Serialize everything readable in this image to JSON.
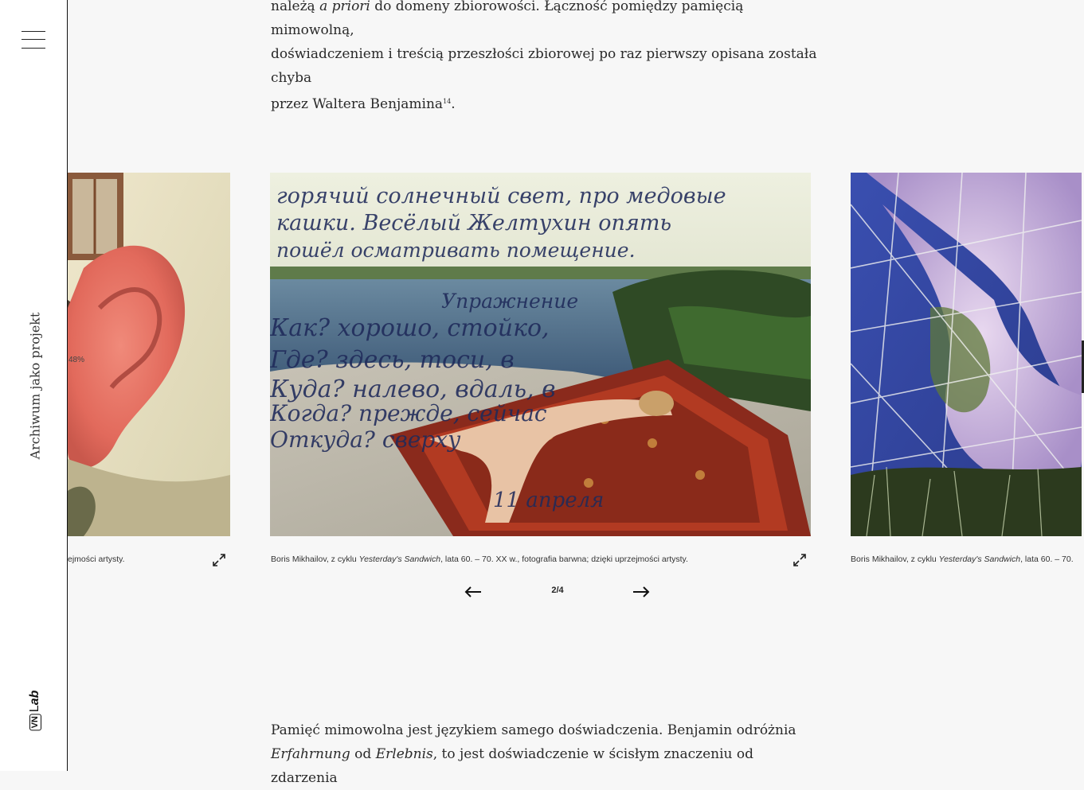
{
  "sidebar": {
    "vertical_title": "Archiwum jako projekt",
    "logo_box": "VN",
    "logo_l": "L",
    "logo_ab": "ab"
  },
  "article": {
    "p1_l1_a": "należą ",
    "p1_l1_i": "a priori",
    "p1_l1_b": " do domeny zbiorowości. Łączność pomiędzy pamięcią mimowolną,",
    "p1_l2": "doświadczeniem i treścią przeszłości zbiorowej po raz pierwszy opisana została chyba",
    "p1_l3": "przez Waltera Benjamina",
    "p1_sup": "14",
    "p1_end": ".",
    "p2_l1": "Pamięć mimowolna jest językiem samego doświadczenia. Benjamin odróżnia",
    "p2_l2_i1": "Erfahrnung",
    "p2_l2_a": " od ",
    "p2_l2_i2": "Erlebnis",
    "p2_l2_b": ", to jest doświadczenie w ścisłym znaczeniu od zdarzenia"
  },
  "gallery": {
    "left_caption": "ejmości artysty.",
    "left_percent": "48%",
    "center_caption_a": "Boris Mikhailov, z cyklu ",
    "center_caption_i": "Yesterday's Sandwich",
    "center_caption_b": ", lata 60. – 70. XX w., fotografia barwna; dzięki uprzejmości artysty.",
    "right_caption_a": "Boris Mikhailov, z cyklu ",
    "right_caption_i": "Yesterday's Sandwich",
    "right_caption_b": ", lata 60. – 70.",
    "handwriting": [
      "горячий солнечный свет, про медовые",
      "кашки. Весёлый Желтухин опять",
      "пошёл осматривать помещение.",
      "Упражнение",
      "Как? хорошо, стойко,",
      "Где? здесь, тоси, в",
      "Куда? налево, вдаль, в",
      "Когда? прежде, сейчас",
      "Откуда? сверху",
      "11 апреля"
    ],
    "pager": {
      "current": "2/4"
    }
  }
}
